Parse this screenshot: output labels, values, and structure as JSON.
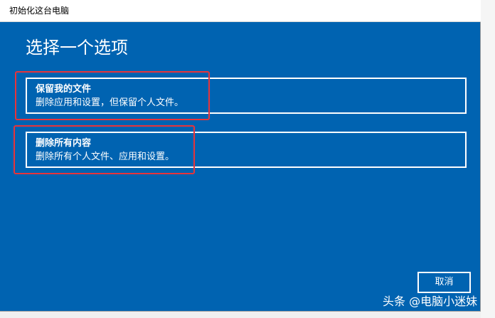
{
  "window": {
    "title": "初始化这台电脑"
  },
  "main": {
    "heading": "选择一个选项",
    "options": [
      {
        "title": "保留我的文件",
        "description": "删除应用和设置，但保留个人文件。"
      },
      {
        "title": "删除所有内容",
        "description": "删除所有个人文件、应用和设置。"
      }
    ]
  },
  "footer": {
    "cancel_label": "取消"
  },
  "watermark": {
    "text": "头条 @电脑小迷妹"
  },
  "colors": {
    "background": "#0063b1",
    "highlight": "#e8343a",
    "titlebar": "#ffffff"
  }
}
